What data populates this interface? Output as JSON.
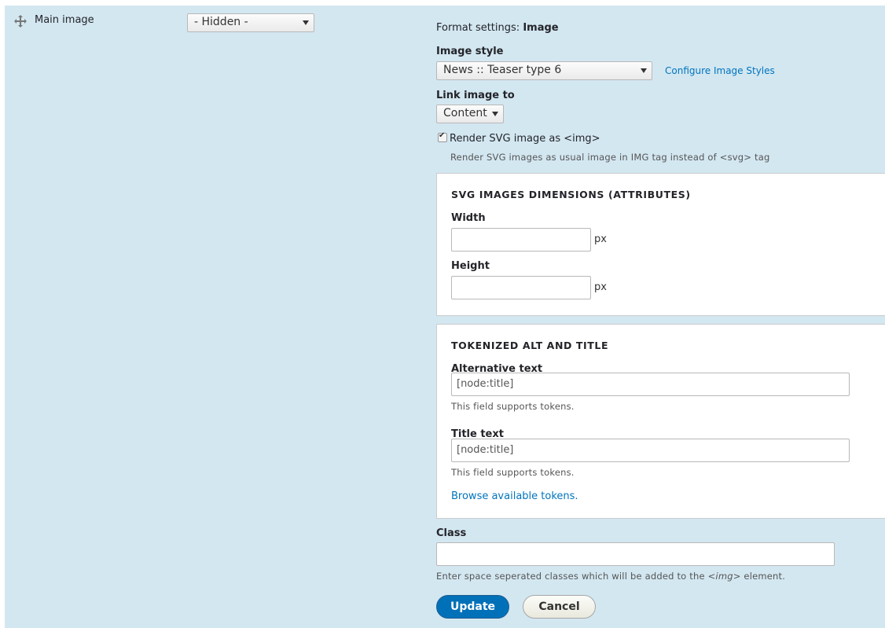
{
  "row": {
    "field_name": "Main image",
    "region_select_value": "- Hidden -"
  },
  "format": {
    "settings_prefix": "Format settings:",
    "settings_name": "Image",
    "image_style_label": "Image style",
    "image_style_value": "News :: Teaser type 6",
    "configure_link": "Configure Image Styles",
    "link_image_label": "Link image to",
    "link_image_value": "Content",
    "render_svg_label": "Render SVG image as <img>",
    "render_svg_checked": true,
    "render_svg_desc": "Render SVG images as usual image in IMG tag instead of <svg> tag"
  },
  "svg_dimensions": {
    "title": "SVG IMAGES DIMENSIONS (ATTRIBUTES)",
    "width_label": "Width",
    "width_value": "",
    "width_unit": "px",
    "height_label": "Height",
    "height_value": "",
    "height_unit": "px"
  },
  "tokens": {
    "title": "TOKENIZED ALT AND TITLE",
    "alt_label": "Alternative text",
    "alt_value": "[node:title]",
    "alt_desc": "This field supports tokens.",
    "title_label": "Title text",
    "title_value": "[node:title]",
    "title_desc": "This field supports tokens.",
    "browse_link": "Browse available tokens."
  },
  "class_field": {
    "label": "Class",
    "value": "",
    "desc_before": "Enter space seperated classes which will be added to the ",
    "desc_code": "<img>",
    "desc_after": " element."
  },
  "actions": {
    "update_label": "Update",
    "cancel_label": "Cancel"
  },
  "colors": {
    "row_background": "#d3e7f1",
    "primary_button": "#0071b8",
    "link": "#0074bd"
  },
  "icons": {
    "drag": "move-icon",
    "dropdown": "chevron-down-icon",
    "checkbox": "check-icon"
  }
}
